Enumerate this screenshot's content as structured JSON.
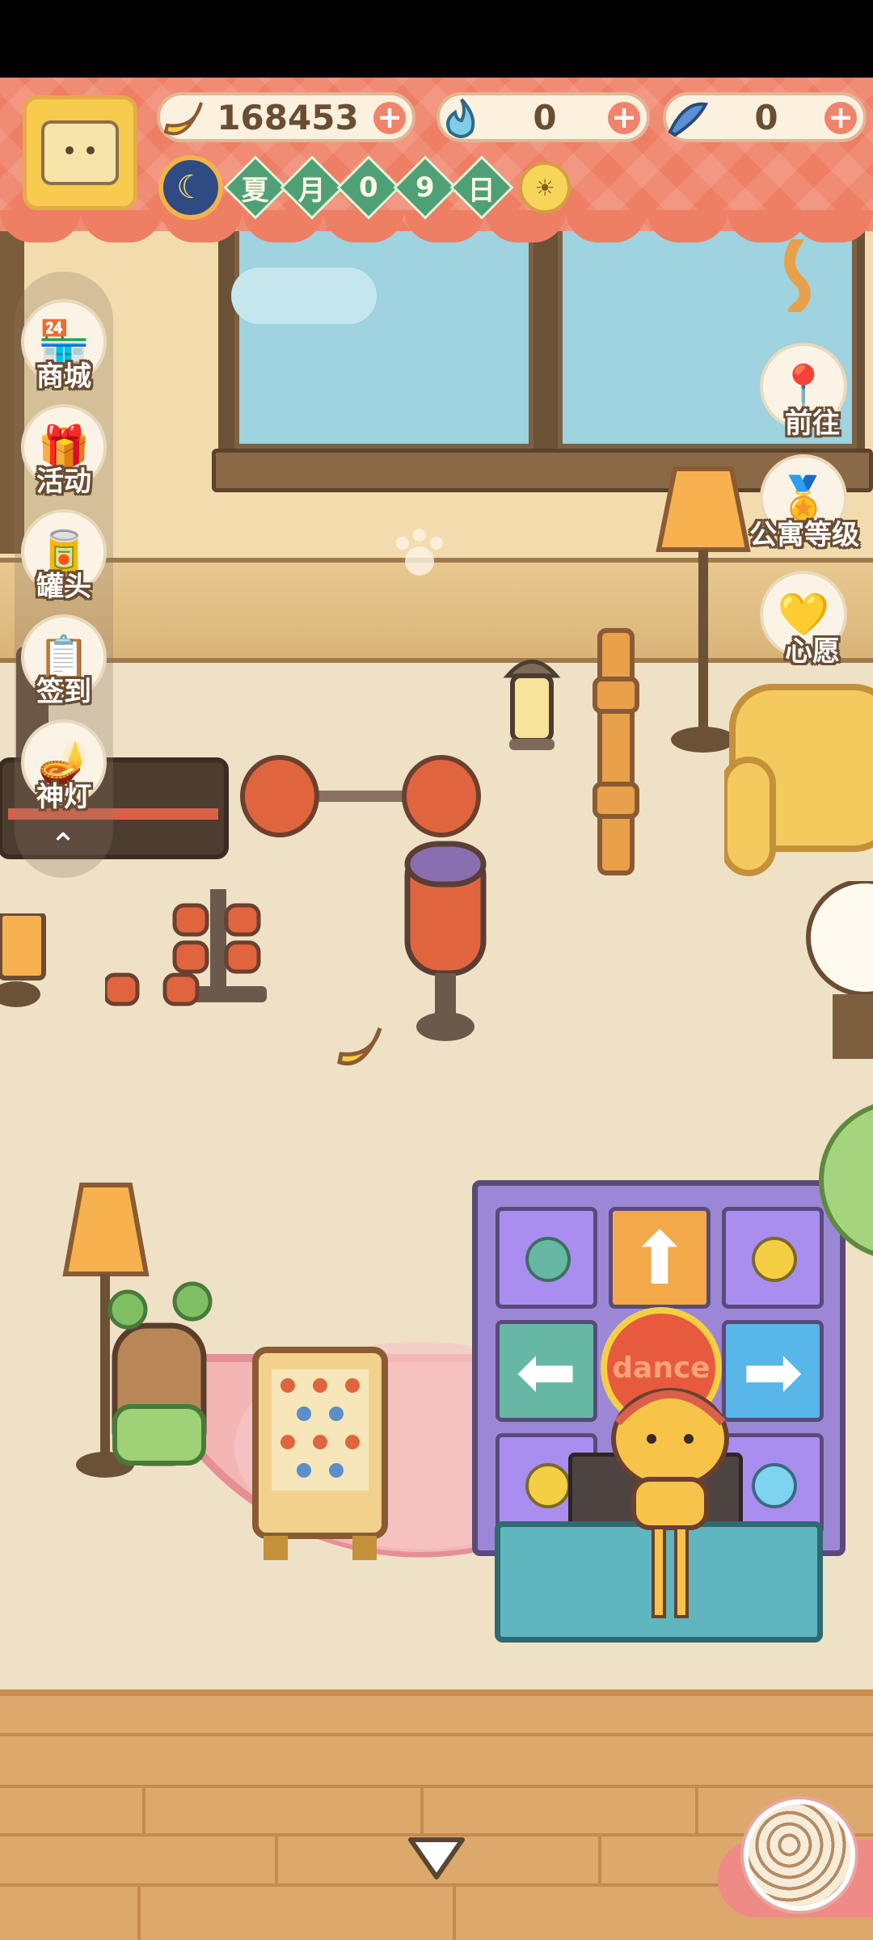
{
  "resources": {
    "banana": {
      "value": "168453",
      "icon": "banana-icon"
    },
    "blue_flame": {
      "value": "0",
      "icon": "blue-flame-icon"
    },
    "fish": {
      "value": "0",
      "icon": "blue-fish-icon"
    },
    "plus": "+"
  },
  "season": {
    "icon": "moon-season-icon",
    "date_chars": [
      "夏",
      "月",
      "0",
      "9",
      "日"
    ],
    "weather_icon": "sun-weather-icon"
  },
  "left_menu": {
    "items": [
      {
        "label": "商城",
        "icon": "shop-icon",
        "glyph": "🏪"
      },
      {
        "label": "活动",
        "icon": "gift-icon",
        "glyph": "🎁"
      },
      {
        "label": "罐头",
        "icon": "can-icon",
        "glyph": "🥫"
      },
      {
        "label": "签到",
        "icon": "checkin-icon",
        "glyph": "📋"
      },
      {
        "label": "神灯",
        "icon": "magic-lamp-icon",
        "glyph": "🪔"
      }
    ],
    "collapse_glyph": "⌃"
  },
  "right_menu": {
    "items": [
      {
        "label": "前往",
        "icon": "map-pin-icon",
        "glyph": "📍"
      },
      {
        "label": "公寓等级",
        "icon": "apartment-level-icon",
        "glyph": "🏅"
      },
      {
        "label": "心愿",
        "icon": "wish-book-icon",
        "glyph": "💛"
      }
    ]
  },
  "scene": {
    "dance_machine_text": "dance",
    "colors": {
      "awning": "#ee7e64",
      "wall": "#f2dcae",
      "floor": "#efe1c6",
      "rug": "#f3b6b4",
      "dance_frame": "#9c87d6"
    }
  }
}
